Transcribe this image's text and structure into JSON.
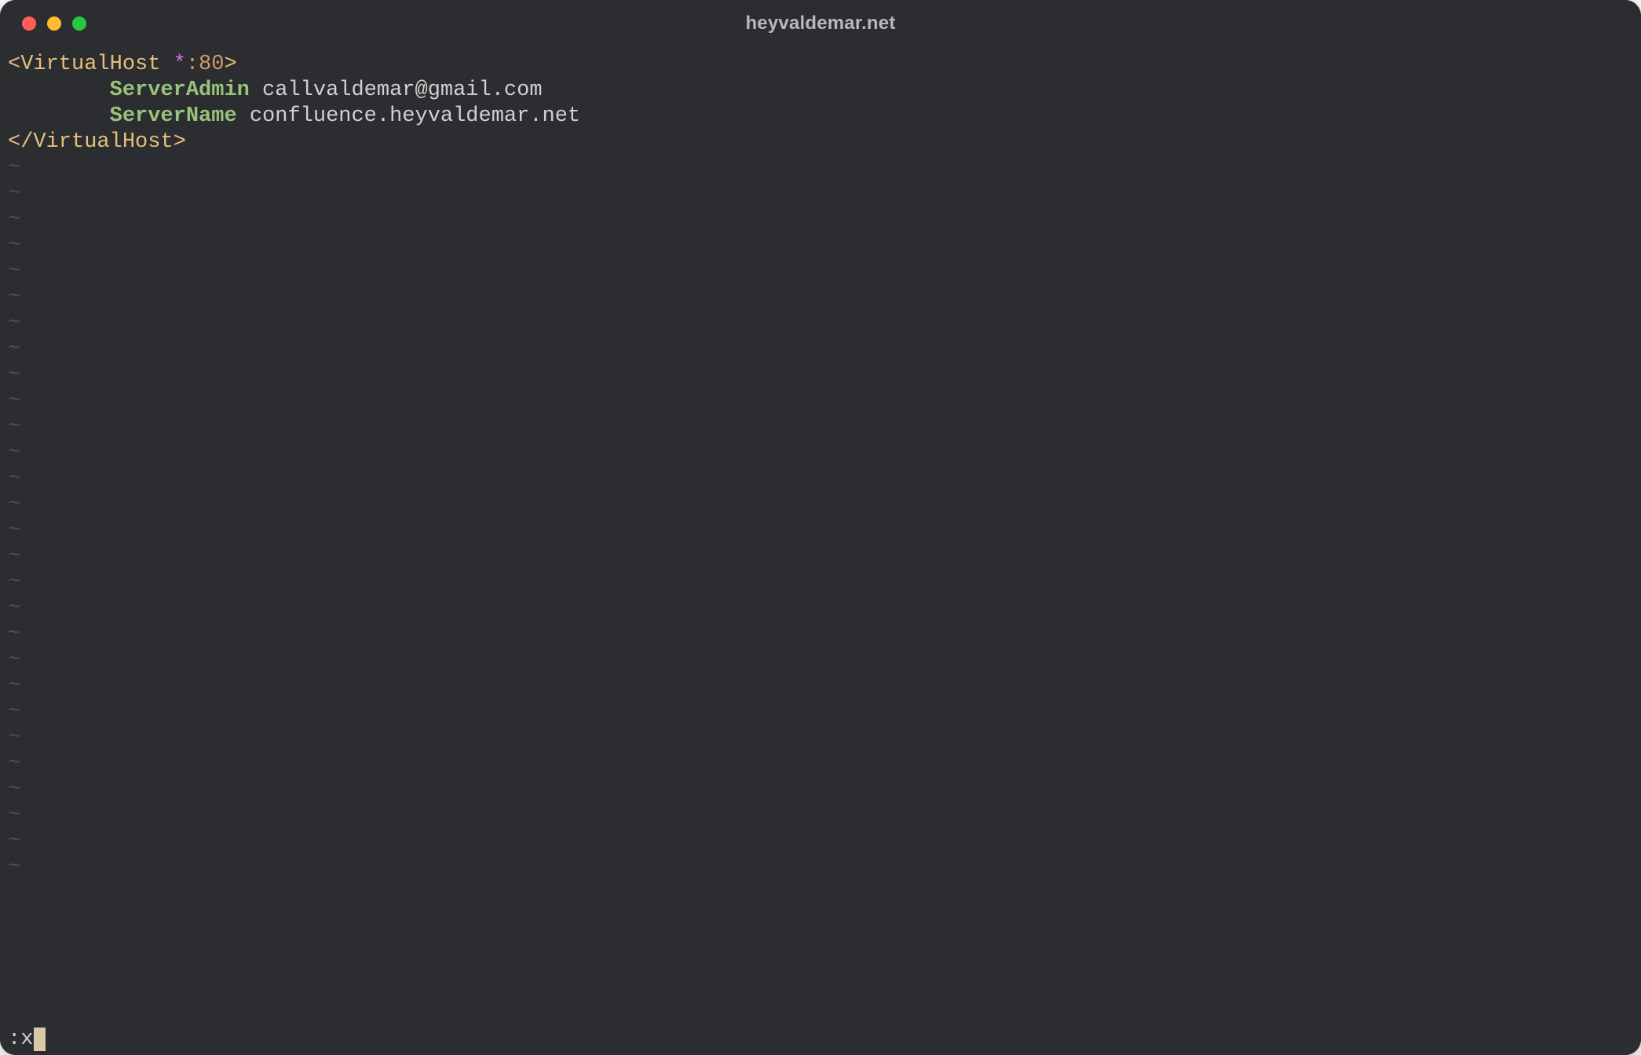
{
  "window": {
    "title": "heyvaldemar.net"
  },
  "traffic_lights": {
    "close": "#ff5f57",
    "minimize": "#febc2e",
    "zoom": "#28c840"
  },
  "editor": {
    "lines": [
      {
        "type": "tag_open",
        "tag_open": "<VirtualHost ",
        "star": "*",
        "port": ":80",
        "tag_close": ">"
      },
      {
        "type": "directive",
        "indent": "        ",
        "key": "ServerAdmin",
        "value": " callvaldemar@gmail.com"
      },
      {
        "type": "directive",
        "indent": "        ",
        "key": "ServerName",
        "value": " confluence.heyvaldemar.net"
      },
      {
        "type": "tag_close",
        "text": "</VirtualHost>"
      }
    ],
    "tilde_char": "~",
    "tilde_count": 28
  },
  "command": {
    "prefix": ":",
    "text": "x"
  }
}
